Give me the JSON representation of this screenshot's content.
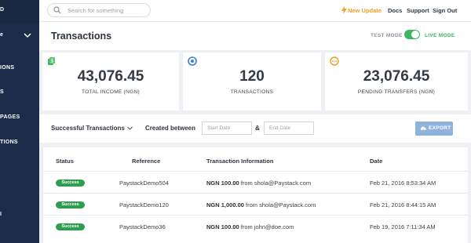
{
  "sidebar": {
    "items": [
      {
        "label": "D"
      },
      {
        "label": "e"
      },
      {
        "label": "IONS"
      },
      {
        "label": "S"
      },
      {
        "label": "PAGES"
      },
      {
        "label": "TIONS"
      },
      {
        "label": "I"
      }
    ]
  },
  "topbar": {
    "search_placeholder": "Search for something",
    "new_update": "New Update",
    "docs": "Docs",
    "support": "Support",
    "sign_out": "Sign Out"
  },
  "header": {
    "title": "Transactions",
    "test_mode": "TEST MODE",
    "live_mode": "LIVE MODE",
    "live_mode_on": true
  },
  "stats": [
    {
      "icon": "money-icon",
      "value": "43,076.45",
      "label": "TOTAL INCOME (NGN)"
    },
    {
      "icon": "transactions-icon",
      "value": "120",
      "label": "TRANSACTIONS"
    },
    {
      "icon": "pending-icon",
      "value": "23,076.45",
      "label": "PENDING TRANSFERS (NGN)"
    }
  ],
  "filter": {
    "status": "Successful Transactions",
    "created_between": "Created between",
    "start_placeholder": "Start Date",
    "amp": "&",
    "end_placeholder": "End Date",
    "export": "EXPORT"
  },
  "table": {
    "columns": [
      "Status",
      "Reference",
      "Transaction Information",
      "Date"
    ],
    "rows": [
      {
        "status": "Success",
        "reference": "PaystackDemo504",
        "amount": "NGN 100.00",
        "info": "from shola@Paystack.com",
        "date": "Feb 21, 2016 8:53:34 AM"
      },
      {
        "status": "Success",
        "reference": "PaystackDemo120",
        "amount": "NGN 1,000.00",
        "info": "from shola@Paystack.com",
        "date": "Feb 21, 2016 8:44:15 AM"
      },
      {
        "status": "Success",
        "reference": "PaystackDemo36",
        "amount": "NGN 100.00",
        "info": "from john@doe.com",
        "date": "Feb 19, 2016 7:11:34 AM"
      }
    ]
  },
  "colors": {
    "sidebar": "#1d2b4a",
    "success": "#2e9e4f",
    "toggle": "#3bb75e",
    "export": "#8fb3dc",
    "new_update": "#f0a020"
  }
}
